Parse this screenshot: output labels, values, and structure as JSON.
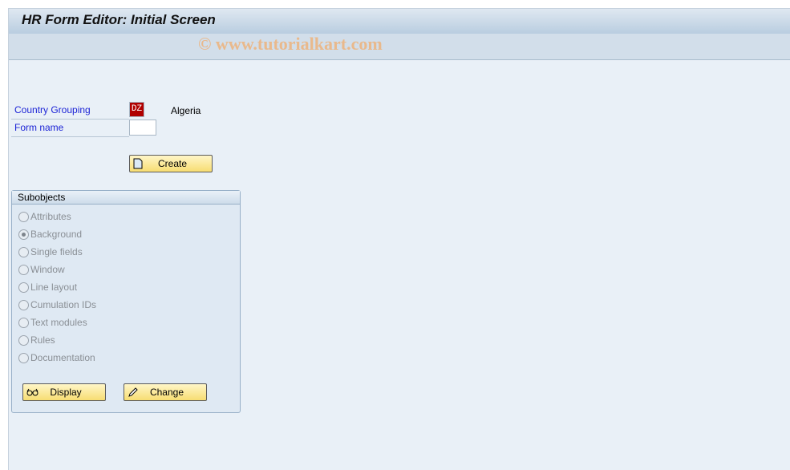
{
  "title": "HR Form Editor: Initial Screen",
  "watermark": "© www.tutorialkart.com",
  "fields": {
    "country_grouping": {
      "label": "Country Grouping",
      "value": "DZ",
      "description": "Algeria"
    },
    "form_name": {
      "label": "Form name",
      "value": ""
    }
  },
  "create_button": {
    "label": "Create",
    "icon": "document-icon"
  },
  "subobjects": {
    "title": "Subobjects",
    "options": [
      {
        "label": "Attributes",
        "selected": false
      },
      {
        "label": "Background",
        "selected": true
      },
      {
        "label": "Single fields",
        "selected": false
      },
      {
        "label": "Window",
        "selected": false
      },
      {
        "label": "Line layout",
        "selected": false
      },
      {
        "label": "Cumulation IDs",
        "selected": false
      },
      {
        "label": "Text modules",
        "selected": false
      },
      {
        "label": "Rules",
        "selected": false
      },
      {
        "label": "Documentation",
        "selected": false
      }
    ],
    "display_button": {
      "label": "Display",
      "icon": "glasses-icon"
    },
    "change_button": {
      "label": "Change",
      "icon": "pencil-icon"
    }
  }
}
